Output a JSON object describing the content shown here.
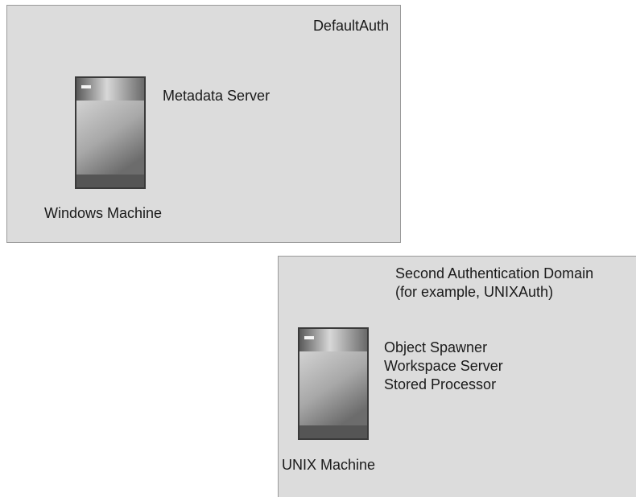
{
  "domains": {
    "default": {
      "name": "DefaultAuth",
      "server": "Metadata Server",
      "machine": "Windows Machine"
    },
    "second": {
      "name_line1": "Second Authentication Domain",
      "name_line2": "(for example, UNIXAuth)",
      "servers": [
        "Object Spawner",
        "Workspace Server",
        "Stored Processor"
      ],
      "machine": "UNIX Machine"
    }
  },
  "colors": {
    "domain_fill": "#dcdcdc",
    "domain_border": "#9a9a9a",
    "server_body_light": "#d4d4d4",
    "server_body_dark": "#6a6a6a",
    "server_base": "#4a4a4a"
  },
  "icons": [
    "server-icon",
    "server-icon"
  ]
}
